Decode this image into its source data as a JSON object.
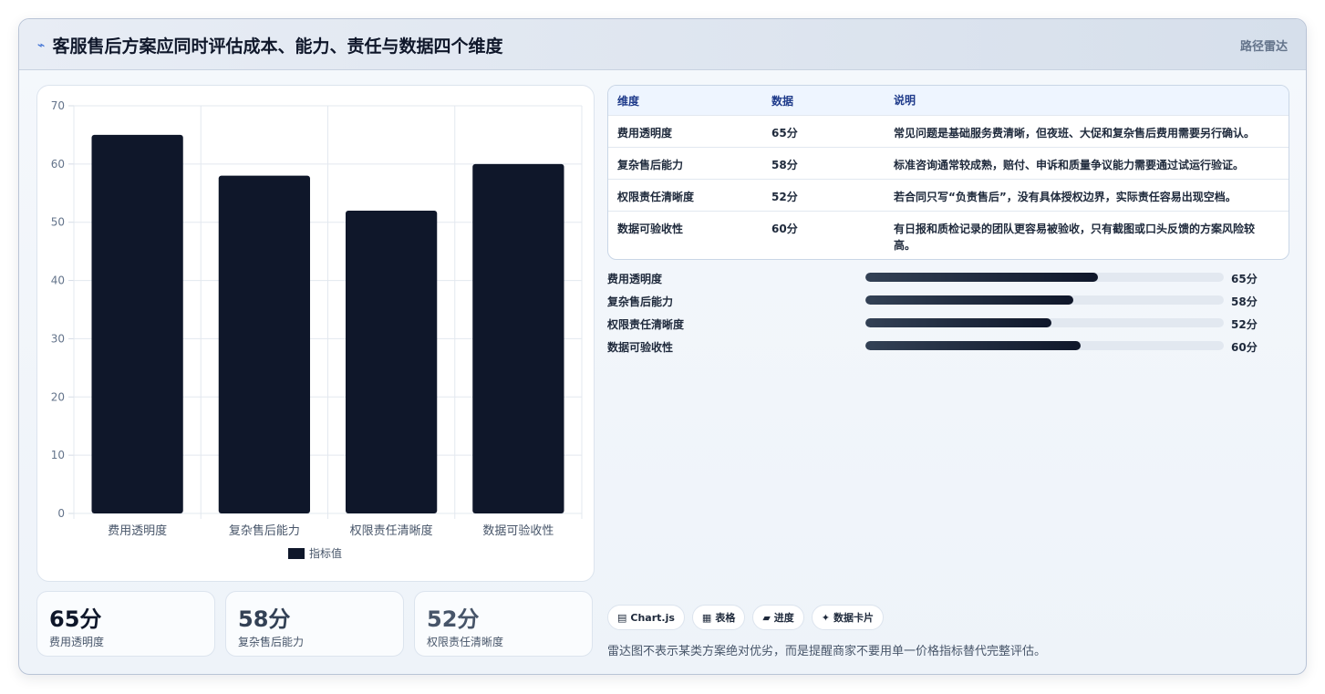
{
  "header": {
    "title": "客服售后方案应同时评估成本、能力、责任与数据四个维度",
    "nav": "路径雷达"
  },
  "chart_data": {
    "type": "bar",
    "categories": [
      "费用透明度",
      "复杂售后能力",
      "权限责任清晰度",
      "数据可验收性"
    ],
    "series": [
      {
        "name": "指标值",
        "values": [
          65,
          58,
          52,
          60
        ],
        "color": "#0f172a"
      }
    ],
    "ylim": [
      0,
      70
    ],
    "yticks": [
      0,
      10,
      20,
      30,
      40,
      50,
      60,
      70
    ],
    "grid": true,
    "legend": "bottom"
  },
  "table": {
    "headers": [
      "维度",
      "数据",
      "说明"
    ],
    "rows": [
      [
        "费用透明度",
        "65分",
        "常见问题是基础服务费清晰，但夜班、大促和复杂售后费用需要另行确认。"
      ],
      [
        "复杂售后能力",
        "58分",
        "标准咨询通常较成熟，赔付、申诉和质量争议能力需要通过试运行验证。"
      ],
      [
        "权限责任清晰度",
        "52分",
        "若合同只写“负责售后”，没有具体授权边界，实际责任容易出现空档。"
      ],
      [
        "数据可验收性",
        "60分",
        "有日报和质检记录的团队更容易被验收，只有截图或口头反馈的方案风险较高。"
      ]
    ]
  },
  "progress": [
    {
      "label": "费用透明度",
      "value": 65,
      "text": "65分"
    },
    {
      "label": "复杂售后能力",
      "value": 58,
      "text": "58分"
    },
    {
      "label": "权限责任清晰度",
      "value": 52,
      "text": "52分"
    },
    {
      "label": "数据可验收性",
      "value": 60,
      "text": "60分"
    }
  ],
  "stats": [
    {
      "value": "65分",
      "label": "费用透明度",
      "color": "#0f172a"
    },
    {
      "value": "58分",
      "label": "复杂售后能力",
      "color": "#334155"
    },
    {
      "value": "52分",
      "label": "权限责任清晰度",
      "color": "#475569"
    }
  ],
  "tags": [
    {
      "icon": "▤",
      "icon_name": "chart-icon",
      "label": "Chart.js"
    },
    {
      "icon": "▦",
      "icon_name": "table-icon",
      "label": "表格"
    },
    {
      "icon": "▰",
      "icon_name": "progress-icon",
      "label": "进度"
    },
    {
      "icon": "✦",
      "icon_name": "card-icon",
      "label": "数据卡片"
    }
  ],
  "note": "雷达图不表示某类方案绝对优劣，而是提醒商家不要用单一价格指标替代完整评估。"
}
